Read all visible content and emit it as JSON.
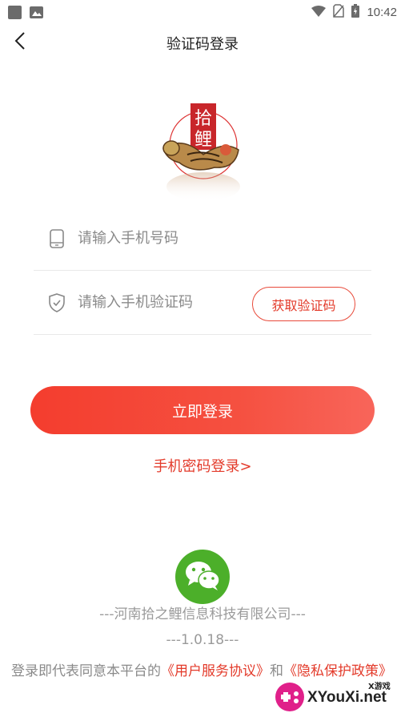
{
  "status_bar": {
    "time": "10:42"
  },
  "header": {
    "title": "验证码登录"
  },
  "logo": {
    "text_top": "拾",
    "text_bottom": "鲤"
  },
  "form": {
    "phone_placeholder": "请输入手机号码",
    "code_placeholder": "请输入手机验证码",
    "get_code_label": "获取验证码"
  },
  "login_button": "立即登录",
  "password_login_link": "手机密码登录>",
  "footer": {
    "company": "---河南拾之鲤信息科技有限公司---",
    "version": "---1.0.18---",
    "agreement_prefix": "登录即代表同意本平台的",
    "user_agreement": "《用户服务协议》",
    "agreement_and": "和",
    "privacy_policy": "《隐私保护政策》"
  },
  "watermark": {
    "brand": "XYouXi.net",
    "sub": "X游戏"
  },
  "colors": {
    "accent": "#e33a2a",
    "wechat": "#4caf2a"
  }
}
